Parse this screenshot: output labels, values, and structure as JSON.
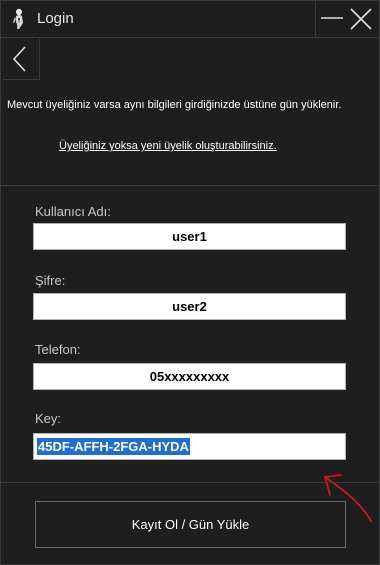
{
  "window": {
    "title": "Login"
  },
  "info": {
    "message": "Mevcut üyeliğiniz varsa aynı bilgileri girdiğinizde üstüne gün yüklenir.",
    "register_link": "Üyeliğiniz yoksa yeni üyelik oluşturabilirsiniz."
  },
  "form": {
    "username_label": "Kullanıcı Adı:",
    "username_value": "user1",
    "password_label": "Şifre:",
    "password_value": "user2",
    "phone_label": "Telefon:",
    "phone_value": "05xxxxxxxxx",
    "key_label": "Key:",
    "key_value": "45DF-AFFH-2FGA-HYDA",
    "submit_label": "Kayıt Ol / Gün Yükle"
  },
  "icons": {
    "app": "figure-icon",
    "minimize": "minimize-icon",
    "close": "close-icon",
    "back": "chevron-left-icon",
    "annotation": "red-arrow-annotation"
  },
  "colors": {
    "background": "#1e1e1e",
    "selection": "#1e6fd0",
    "annotation": "#d01818"
  }
}
